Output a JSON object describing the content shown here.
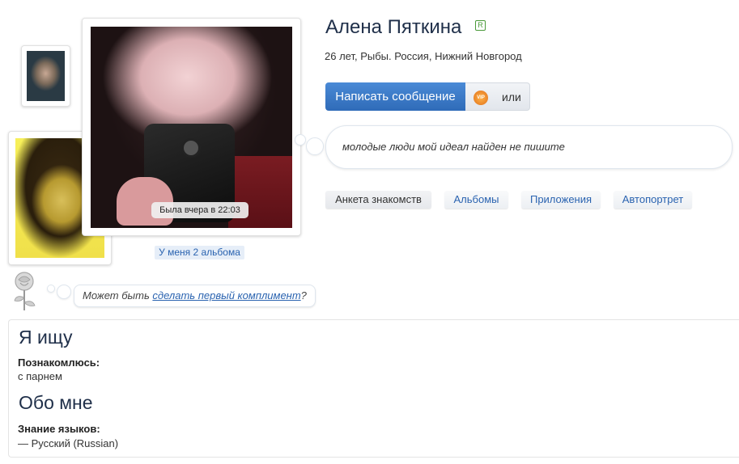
{
  "profile": {
    "name": "Алена Пяткина",
    "reg_badge": "R",
    "meta": "26 лет, Рыбы. Россия, Нижний Новгород",
    "status": "Была вчера в 22:03",
    "albums_link": "У меня 2 альбома"
  },
  "actions": {
    "message_button": "Написать сообщение",
    "vip_icon_text": "VIP",
    "or_label": "или"
  },
  "bubble": {
    "text": "молодые люди мой идеал найден не пишите"
  },
  "tabs": [
    {
      "label": "Анкета знакомств",
      "active": true
    },
    {
      "label": "Альбомы",
      "active": false
    },
    {
      "label": "Приложения",
      "active": false
    },
    {
      "label": "Автопортрет",
      "active": false
    }
  ],
  "compliment": {
    "prefix": "Может быть ",
    "link": "сделать первый комплимент",
    "suffix": "?"
  },
  "sections": {
    "seeking_title": "Я ищу",
    "seeking_label": "Познакомлюсь:",
    "seeking_value": "с парнем",
    "about_title": "Обо мне",
    "languages_label": "Знание языков:",
    "languages_value": "— Русский (Russian)"
  },
  "colors": {
    "accent": "#2f6bb8",
    "link": "#2a63b0",
    "heading": "#1f2f49"
  },
  "icons": {
    "rose": "rose-icon",
    "vip": "vip-icon"
  }
}
